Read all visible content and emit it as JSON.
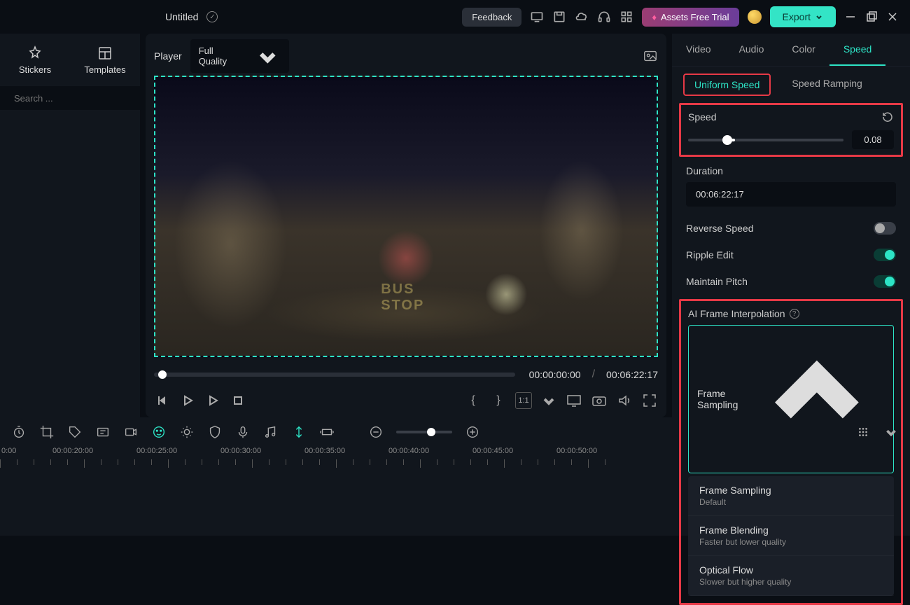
{
  "titlebar": {
    "project_name": "Untitled",
    "feedback": "Feedback",
    "assets_trial": "Assets Free Trial",
    "export": "Export"
  },
  "sidebar": {
    "tabs": {
      "stickers": "Stickers",
      "templates": "Templates"
    },
    "search_placeholder": "Search ..."
  },
  "preview": {
    "player_label": "Player",
    "quality": "Full Quality",
    "current_time": "00:00:00:00",
    "total_time": "00:06:22:17",
    "road_text": "BUS\nSTOP"
  },
  "props": {
    "tabs": {
      "video": "Video",
      "audio": "Audio",
      "color": "Color",
      "speed": "Speed"
    },
    "speed_subtabs": {
      "uniform": "Uniform Speed",
      "ramping": "Speed Ramping"
    },
    "speed_label": "Speed",
    "speed_value": "0.08",
    "duration_label": "Duration",
    "duration_value": "00:06:22:17",
    "reverse_label": "Reverse Speed",
    "ripple_label": "Ripple Edit",
    "pitch_label": "Maintain Pitch",
    "ai_label": "AI Frame Interpolation",
    "ai_selected": "Frame Sampling",
    "ai_options": [
      {
        "title": "Frame Sampling",
        "sub": "Default"
      },
      {
        "title": "Frame Blending",
        "sub": "Faster but lower quality"
      },
      {
        "title": "Optical Flow",
        "sub": "Slower but higher quality"
      }
    ]
  },
  "timeline": {
    "marks": [
      "0:00",
      "00:00:20:00",
      "00:00:25:00",
      "00:00:30:00",
      "00:00:35:00",
      "00:00:40:00",
      "00:00:45:00",
      "00:00:50:00"
    ]
  }
}
